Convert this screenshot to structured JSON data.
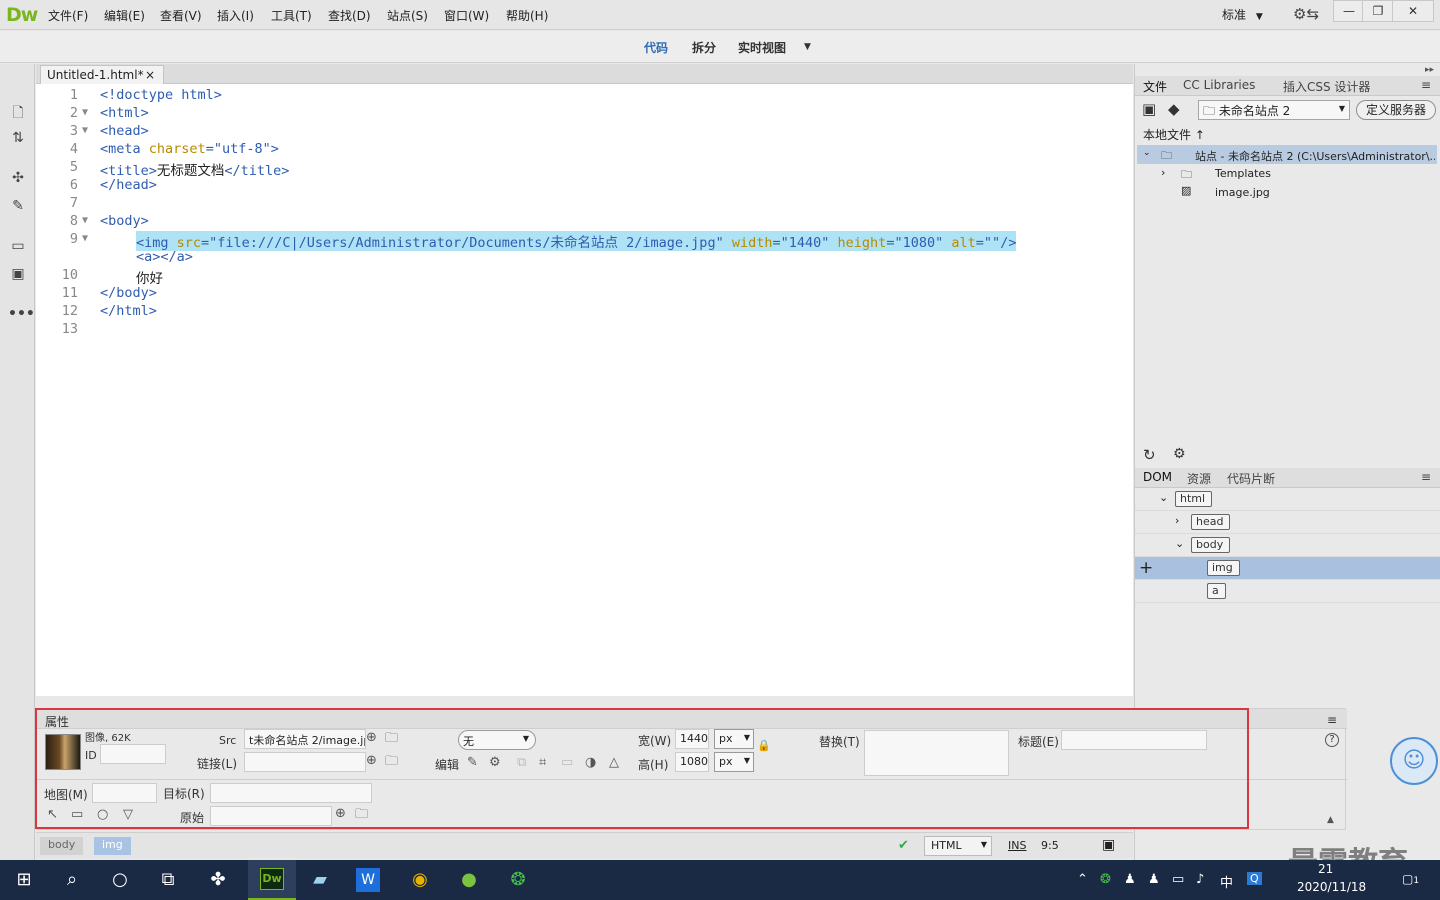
{
  "app": {
    "logo": "Dw",
    "menus": [
      "文件(F)",
      "编辑(E)",
      "查看(V)",
      "插入(I)",
      "工具(T)",
      "查找(D)",
      "站点(S)",
      "窗口(W)",
      "帮助(H)"
    ],
    "layout_label": "标准",
    "window_controls": {
      "minimize": "—",
      "restore": "❐",
      "close": "✕"
    }
  },
  "viewbar": {
    "code": "代码",
    "split": "拆分",
    "live": "实时视图"
  },
  "document": {
    "tab_title": "Untitled-1.html*",
    "close": "×",
    "lines": [
      {
        "n": "1",
        "fold": "",
        "indent": 0,
        "parts": [
          [
            "tag",
            "<!doctype html>"
          ]
        ]
      },
      {
        "n": "2",
        "fold": "▼",
        "indent": 0,
        "parts": [
          [
            "tag",
            "<html>"
          ]
        ]
      },
      {
        "n": "3",
        "fold": "▼",
        "indent": 0,
        "parts": [
          [
            "tag",
            "<head>"
          ]
        ]
      },
      {
        "n": "4",
        "fold": "",
        "indent": 0,
        "parts": [
          [
            "tag",
            "<meta "
          ],
          [
            "attr",
            "charset"
          ],
          [
            "tag",
            "="
          ],
          [
            "val",
            "\"utf-8\""
          ],
          [
            "tag",
            ">"
          ]
        ]
      },
      {
        "n": "5",
        "fold": "",
        "indent": 0,
        "parts": [
          [
            "tag",
            "<title>"
          ],
          [
            "txt",
            "无标题文档"
          ],
          [
            "tag",
            "</title>"
          ]
        ]
      },
      {
        "n": "6",
        "fold": "",
        "indent": 0,
        "parts": [
          [
            "tag",
            "</head>"
          ]
        ]
      },
      {
        "n": "7",
        "fold": "",
        "indent": 0,
        "parts": []
      },
      {
        "n": "8",
        "fold": "▼",
        "indent": 0,
        "parts": [
          [
            "tag",
            "<body>"
          ]
        ]
      },
      {
        "n": "9",
        "fold": "▼",
        "indent": 1,
        "selected": true,
        "parts": [
          [
            "tag",
            "<img "
          ],
          [
            "attr",
            "src"
          ],
          [
            "tag",
            "="
          ],
          [
            "val",
            "\"file:///C|/Users/Administrator/Documents/未命名站点 2/image.jpg\""
          ],
          [
            "tag",
            " "
          ],
          [
            "attr",
            "width"
          ],
          [
            "tag",
            "="
          ],
          [
            "val",
            "\"1440\""
          ],
          [
            "tag",
            " "
          ],
          [
            "attr",
            "height"
          ],
          [
            "tag",
            "="
          ],
          [
            "val",
            "\"1080\""
          ],
          [
            "tag",
            " "
          ],
          [
            "attr",
            "alt"
          ],
          [
            "tag",
            "="
          ],
          [
            "val",
            "\"\""
          ],
          [
            "tag",
            "/>"
          ]
        ]
      },
      {
        "n": "",
        "fold": "",
        "indent": 1,
        "parts": [
          [
            "tag",
            "<a></a>"
          ]
        ]
      },
      {
        "n": "10",
        "fold": "",
        "indent": 1,
        "parts": [
          [
            "txt",
            "你好"
          ]
        ]
      },
      {
        "n": "11",
        "fold": "",
        "indent": 0,
        "parts": [
          [
            "tag",
            "</body>"
          ]
        ]
      },
      {
        "n": "12",
        "fold": "",
        "indent": 0,
        "parts": [
          [
            "tag",
            "</html>"
          ]
        ]
      },
      {
        "n": "13",
        "fold": "",
        "indent": 0,
        "parts": []
      }
    ]
  },
  "files_panel": {
    "tabs": [
      "文件",
      "CC Libraries",
      "插入",
      "CSS 设计器"
    ],
    "site_select": "未命名站点 2",
    "define_server": "定义服务器",
    "local_files": "本地文件",
    "site_root": "站点 - 未命名站点 2 (C:\\Users\\Administrator\\...",
    "items": [
      "Templates",
      "image.jpg"
    ]
  },
  "dom_panel": {
    "tabs": [
      "DOM",
      "资源",
      "代码片断"
    ],
    "nodes": [
      {
        "tag": "html",
        "level": 0,
        "arrow": "⌄"
      },
      {
        "tag": "head",
        "level": 1,
        "arrow": "›"
      },
      {
        "tag": "body",
        "level": 1,
        "arrow": "⌄"
      },
      {
        "tag": "img",
        "level": 2,
        "arrow": "",
        "selected": true
      },
      {
        "tag": "a",
        "level": 2,
        "arrow": ""
      }
    ],
    "add": "+"
  },
  "properties": {
    "title": "属性",
    "image_info": "图像, 62K",
    "id_label": "ID",
    "src_label": "Src",
    "src_value": "t未命名站点 2/image.jpg",
    "link_label": "链接(L)",
    "class_value": "无",
    "edit_label": "编辑",
    "width_label": "宽(W)",
    "width_value": "1440",
    "height_label": "高(H)",
    "height_value": "1080",
    "unit_px": "px",
    "alt_label": "替换(T)",
    "title_label": "标题(E)",
    "map_label": "地图(M)",
    "target_label": "目标(R)",
    "original_label": "原始",
    "help": "?"
  },
  "status": {
    "crumbs": [
      "body",
      "img"
    ],
    "doctype": "HTML",
    "ins": "INS",
    "position": "9:5"
  },
  "taskbar": {
    "dw_label": "Dw",
    "ime": "中",
    "time": "21",
    "date": "2020/11/18",
    "notif": "1"
  },
  "watermark": "最需教育",
  "colors": {
    "accent": "#2f6db5",
    "selection": "#aee3f6",
    "highlight": "#d9363e"
  }
}
